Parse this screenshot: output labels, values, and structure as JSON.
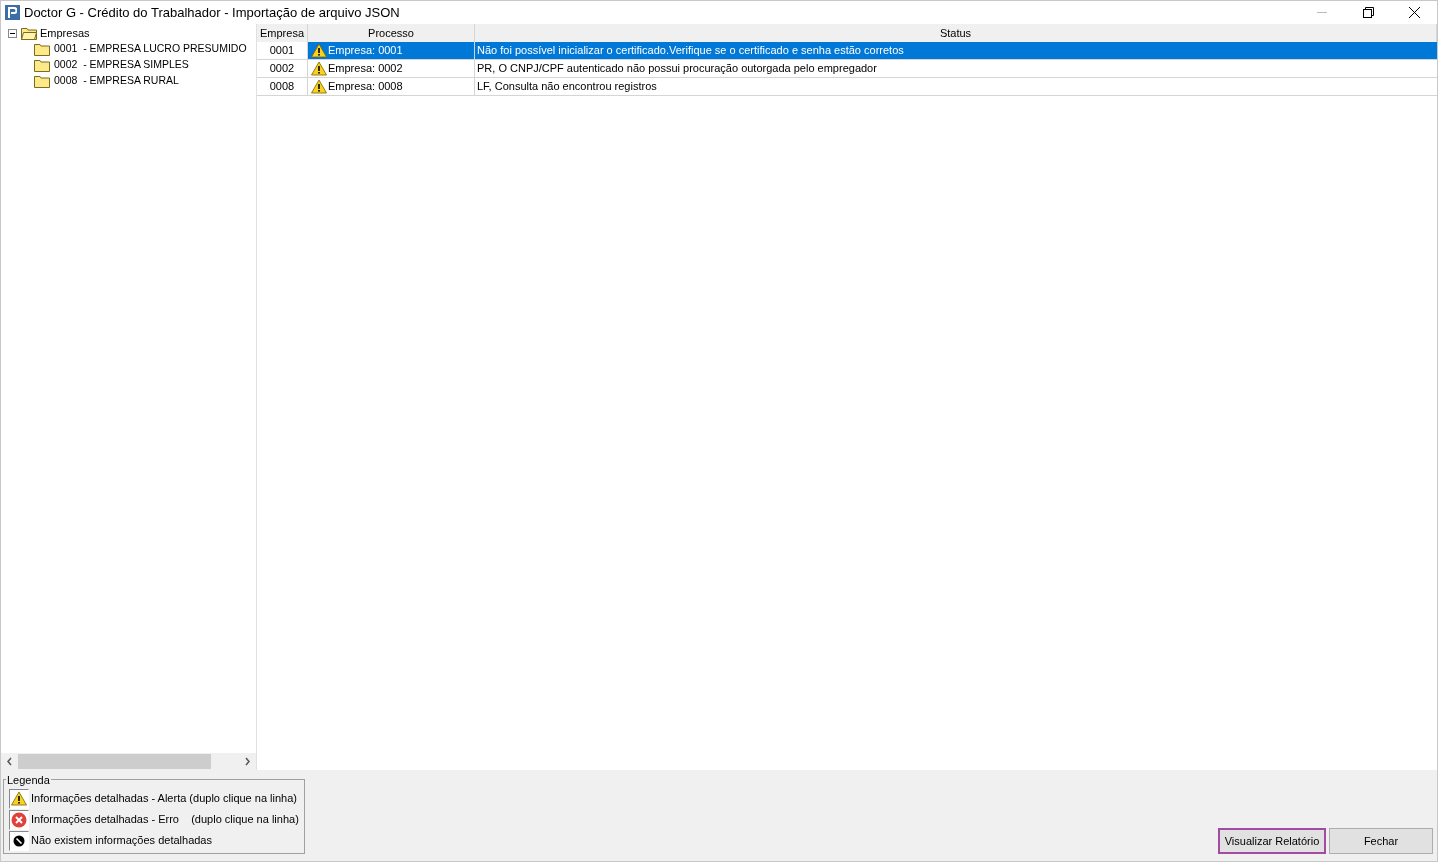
{
  "window": {
    "title": "Doctor G - Crédito do Trabalhador - Importação de arquivo JSON"
  },
  "tree": {
    "label": "Empresas",
    "expanded": true,
    "children": [
      {
        "code": "0001",
        "name": "- EMPRESA LUCRO PRESUMIDO"
      },
      {
        "code": "0002",
        "name": "- EMPRESA SIMPLES"
      },
      {
        "code": "0008",
        "name": "- EMPRESA RURAL"
      }
    ]
  },
  "table": {
    "columns": [
      "Empresa",
      "Processo",
      "Status"
    ],
    "rows": [
      {
        "empresa": "0001",
        "kind": "alert",
        "processo": "Empresa: 0001",
        "status": "Não foi possível inicializar o certificado.Verifique se o certificado e senha estão corretos",
        "selected": true
      },
      {
        "empresa": "0002",
        "kind": "alert",
        "processo": "Empresa: 0002",
        "status": "PR, O CNPJ/CPF autenticado não possui procuração outorgada pelo empregador",
        "selected": false
      },
      {
        "empresa": "0008",
        "kind": "alert",
        "processo": "Empresa: 0008",
        "status": "LF, Consulta não encontrou registros",
        "selected": false
      }
    ]
  },
  "legend": {
    "title": "Legenda",
    "items": [
      {
        "kind": "alert",
        "label": "Informações detalhadas - Alerta (duplo clique na linha)"
      },
      {
        "kind": "error",
        "label": "Informações detalhadas - Erro    (duplo clique na linha)"
      },
      {
        "kind": "none",
        "label": "Não existem informações detalhadas"
      }
    ]
  },
  "buttons": [
    {
      "label": "Visualizar Relatório",
      "focused": true
    },
    {
      "label": "Fechar",
      "focused": false
    }
  ]
}
